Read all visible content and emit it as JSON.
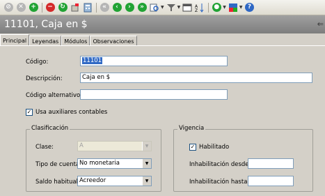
{
  "title": "11101, Caja en $",
  "tabs": [
    "Principal",
    "Leyendas",
    "Módulos",
    "Observaciones"
  ],
  "form": {
    "codigo_label": "Código:",
    "codigo_value": "11101",
    "descripcion_label": "Descripción:",
    "descripcion_value": "Caja en $",
    "codigo_alt_label": "Código alternativo:",
    "codigo_alt_value": "",
    "usa_auxiliares_label": "Usa auxiliares contables",
    "usa_auxiliares_checked": true
  },
  "clasificacion": {
    "legend": "Clasificación",
    "clase_label": "Clase:",
    "clase_value": "A",
    "tipo_label": "Tipo de cuenta:",
    "tipo_value": "No monetaria",
    "saldo_label": "Saldo habitual:",
    "saldo_value": "Acreedor"
  },
  "vigencia": {
    "legend": "Vigencia",
    "habilitado_label": "Habilitado",
    "habilitado_checked": true,
    "desde_label": "Inhabilitación desde:",
    "desde_value": "",
    "hasta_label": "Inhabilitación hasta:",
    "hasta_value": ""
  },
  "toolbar_icons": [
    "cancel-icon",
    "close-icon",
    "add-icon",
    "delete-icon",
    "refresh-icon",
    "clear-icon",
    "calculator-icon",
    "first-icon",
    "previous-icon",
    "next-icon",
    "last-icon",
    "search-icon",
    "filter-icon",
    "view-icon",
    "sort-icon",
    "options-icon",
    "color-icon",
    "help-icon"
  ],
  "colors": {
    "title_bg": "#8c8c8c",
    "selection": "#316ac5",
    "field_border": "#7f9db9"
  }
}
